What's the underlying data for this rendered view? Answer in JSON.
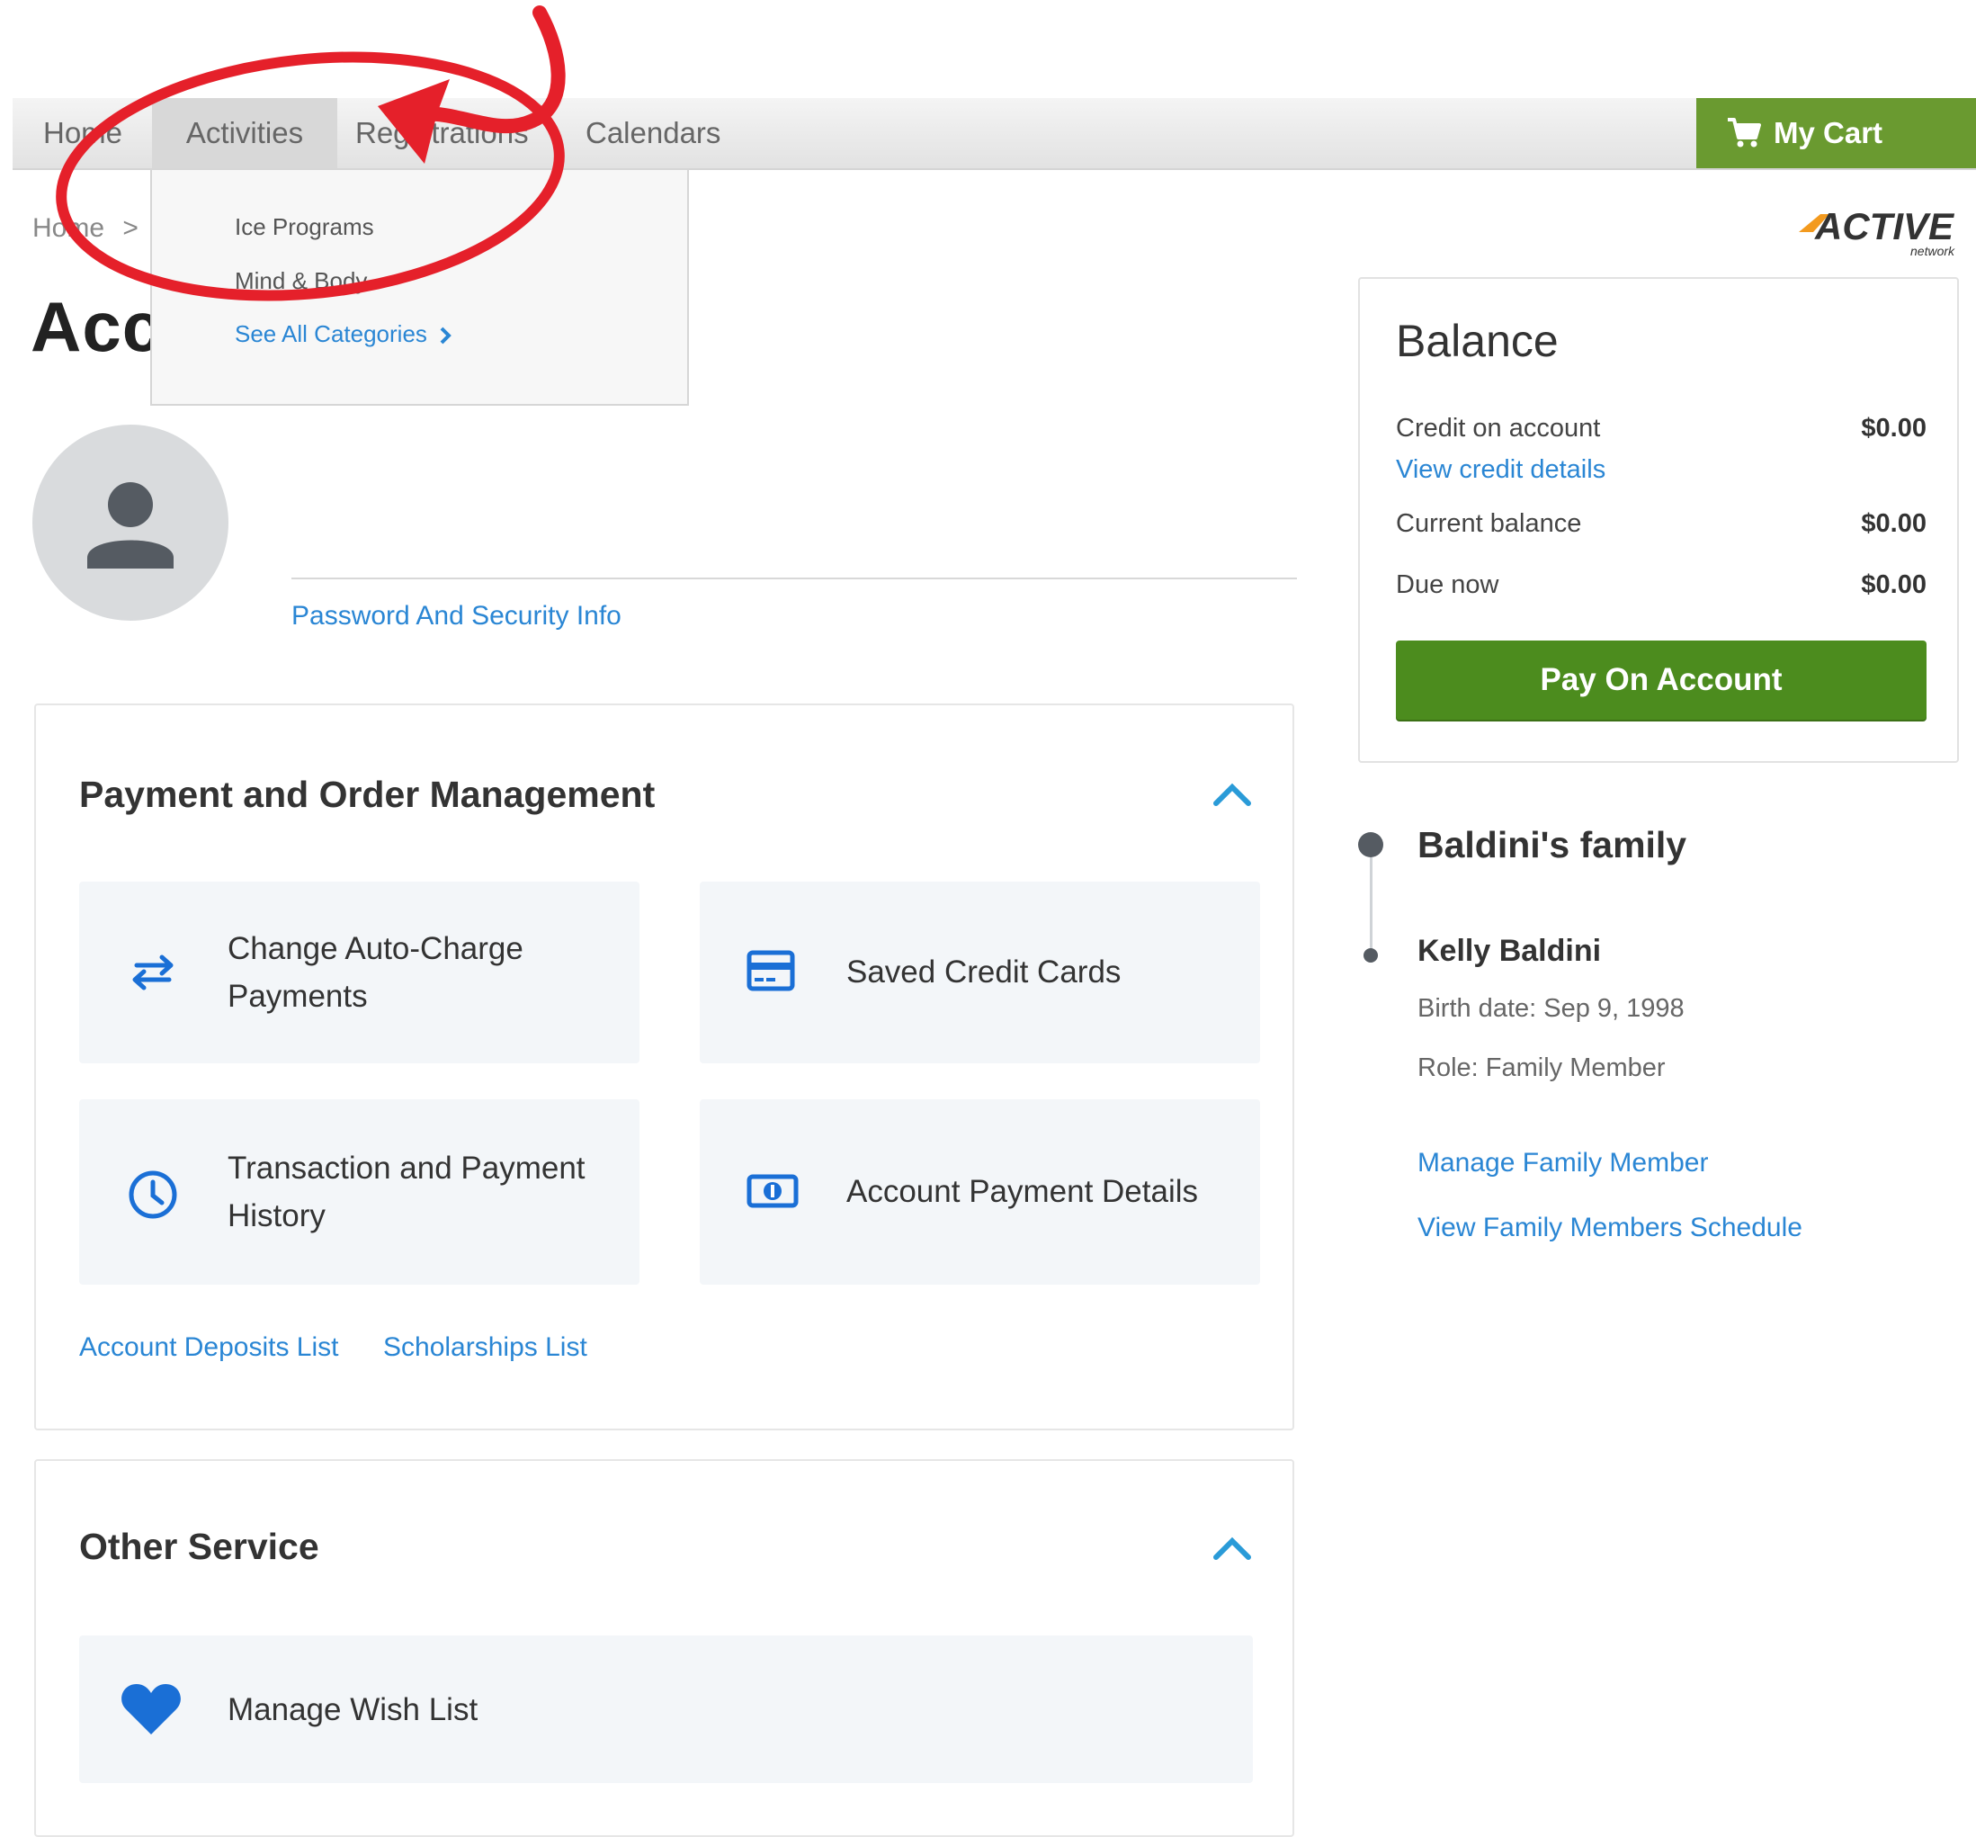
{
  "nav": {
    "home": "Home",
    "activities": "Activities",
    "registrations": "Registrations",
    "calendars": "Calendars",
    "cart": "My Cart"
  },
  "dropdown": {
    "items": [
      "Ice Programs",
      "Mind & Body"
    ],
    "see_all": "See All Categories"
  },
  "breadcrumb": {
    "home": "Home",
    "separator": ">"
  },
  "page_title": "Account",
  "logo": {
    "text": "ACTIVE",
    "subtext": "network"
  },
  "profile": {
    "password_link": "Password And Security Info"
  },
  "payment_section": {
    "title": "Payment and Order Management",
    "tiles": [
      {
        "label_line1": "Change Auto-Charge",
        "label_line2": "Payments",
        "icon": "swap-arrows-icon"
      },
      {
        "label": "Saved Credit Cards",
        "icon": "credit-card-icon"
      },
      {
        "label_line1": "Transaction and Payment",
        "label_line2": "History",
        "icon": "clock-icon"
      },
      {
        "label": "Account Payment Details",
        "icon": "money-icon"
      }
    ],
    "links": [
      "Account Deposits List",
      "Scholarships List"
    ]
  },
  "other_section": {
    "title": "Other Service",
    "tiles": [
      {
        "label": "Manage Wish List",
        "icon": "heart-icon"
      }
    ]
  },
  "balance": {
    "title": "Balance",
    "credit_label": "Credit on account",
    "credit_value": "$0.00",
    "credit_link": "View credit details",
    "current_label": "Current balance",
    "current_value": "$0.00",
    "due_label": "Due now",
    "due_value": "$0.00",
    "pay_button": "Pay On Account"
  },
  "family": {
    "title": "Baldini's family",
    "member_name": "Kelly Baldini",
    "birth_date": "Birth date: Sep 9, 1998",
    "role": "Role: Family Member",
    "manage_link": "Manage Family Member",
    "schedule_link": "View Family Members Schedule"
  },
  "colors": {
    "link": "#2a86d4",
    "cart_green": "#6a9a30",
    "pay_green": "#4c8c1e",
    "annotation_red": "#e5202a",
    "icon_blue": "#1a6fd6"
  }
}
